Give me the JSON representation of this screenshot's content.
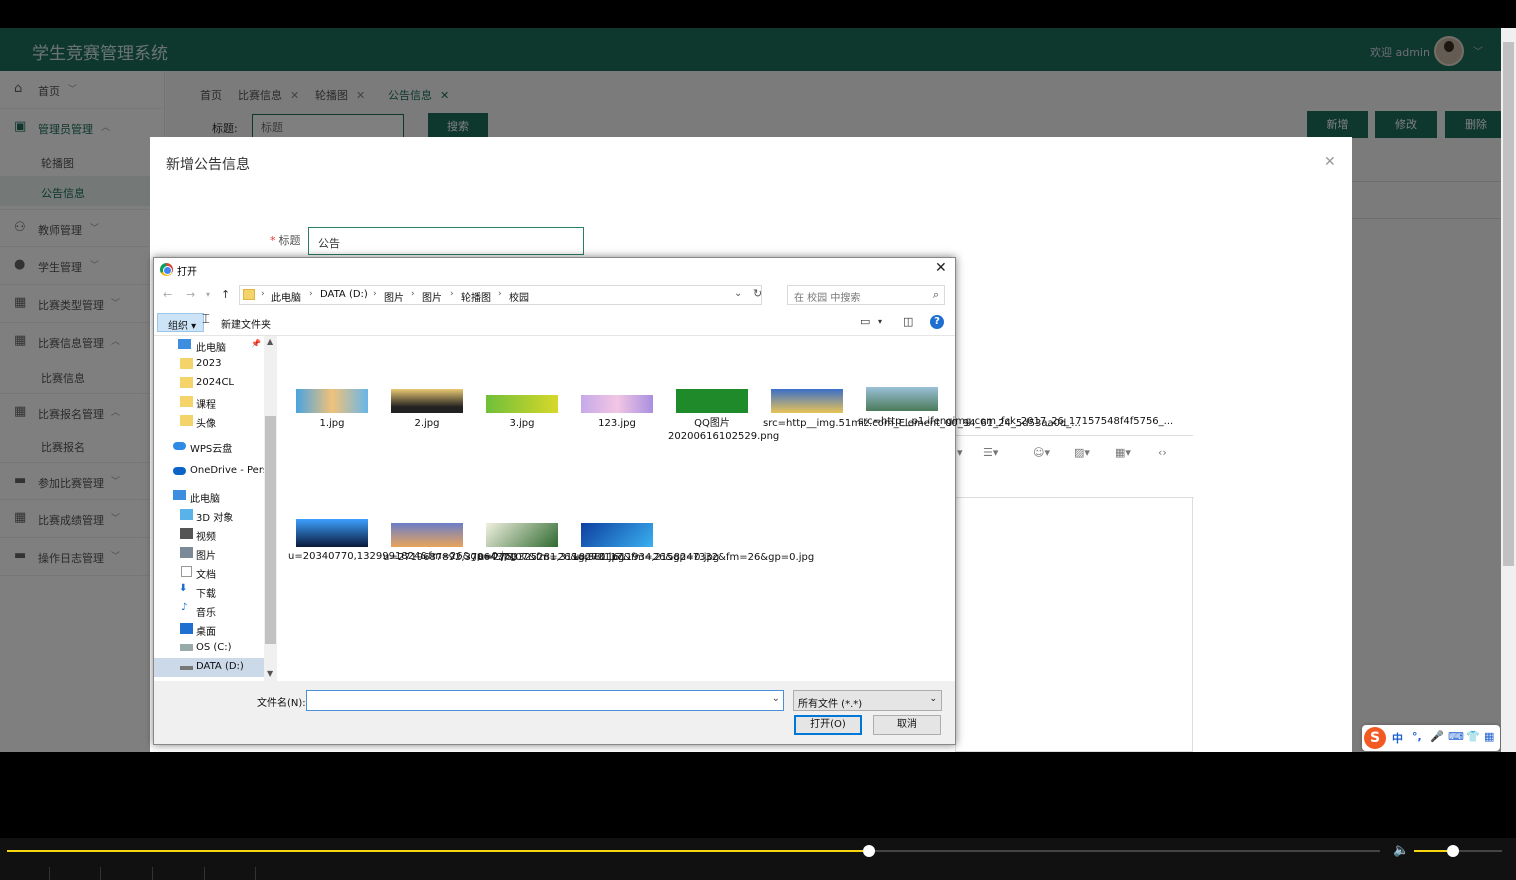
{
  "app": {
    "title": "学生竞赛管理系统",
    "welcome": "欢迎 admin",
    "accent": "#1d6f5d"
  },
  "sidebar": {
    "items": [
      {
        "label": "首页",
        "icon": "home-icon"
      },
      {
        "label": "管理员管理",
        "icon": "admin-icon",
        "sub": [
          "轮播图",
          "公告信息"
        ]
      },
      {
        "label": "教师管理",
        "icon": "user-icon"
      },
      {
        "label": "学生管理",
        "icon": "user-icon"
      },
      {
        "label": "比赛类型管理",
        "icon": "grid-icon"
      },
      {
        "label": "比赛信息管理",
        "icon": "grid-icon",
        "sub": [
          "比赛信息"
        ]
      },
      {
        "label": "比赛报名管理",
        "icon": "grid-icon",
        "sub": [
          "比赛报名"
        ]
      },
      {
        "label": "参加比赛管理",
        "icon": "grid-icon"
      },
      {
        "label": "比赛成绩管理",
        "icon": "grid-icon"
      },
      {
        "label": "操作日志管理",
        "icon": "grid-icon"
      }
    ]
  },
  "tabs": [
    "首页",
    "比赛信息",
    "轮播图",
    "公告信息"
  ],
  "toolbar": {
    "title_label": "标题:",
    "title_placeholder": "标题",
    "search": "搜索",
    "add": "新增",
    "edit": "修改",
    "delete": "删除"
  },
  "modal": {
    "title": "新增公告信息",
    "field_label": "标题",
    "field_value": "公告"
  },
  "dialog": {
    "title": "打开",
    "breadcrumb": [
      "此电脑",
      "DATA (D:)",
      "图片",
      "图片",
      "轮播图",
      "校园"
    ],
    "search_placeholder": "在 校园 中搜索",
    "organize": "组织 ▾",
    "new_folder": "新建文件夹",
    "tree": [
      "此电脑",
      "2023",
      "2024CL",
      "课程",
      "头像",
      "WPS云盘",
      "OneDrive - Perso",
      "此电脑",
      "3D 对象",
      "视频",
      "图片",
      "文档",
      "下载",
      "音乐",
      "桌面",
      "OS (C:)",
      "DATA (D:)"
    ],
    "files": [
      {
        "name": "1.jpg"
      },
      {
        "name": "2.jpg"
      },
      {
        "name": "3.jpg"
      },
      {
        "name": "123.jpg"
      },
      {
        "name": "QQ图片20200616102529.png"
      },
      {
        "name": "src=http__img.51miz.com_Element_00_94_61_24_5d53aa0d_..."
      },
      {
        "name": "src=http__p1.ifengimg.com_fck_2017_26_17157548f4f5756_..."
      },
      {
        "name": "u=20340770,1329991824&fm=26&gp=0.jpg"
      },
      {
        "name": "u=2719687892,3786437107&fm=26&gp=0.jpg"
      },
      {
        "name": "u=2753325281,3118273117&fm=26&gp=0.jpg"
      },
      {
        "name": "u=3811611934,2158247332&fm=26&gp=0.jpg"
      }
    ],
    "filename_label": "文件名(N):",
    "filename_value": "",
    "filetype": "所有文件 (*.*)",
    "open": "打开(O)",
    "cancel": "取消"
  },
  "ime": {
    "chars": [
      "中",
      "°,",
      "🎤",
      "⌨",
      "👕",
      "▦"
    ]
  }
}
